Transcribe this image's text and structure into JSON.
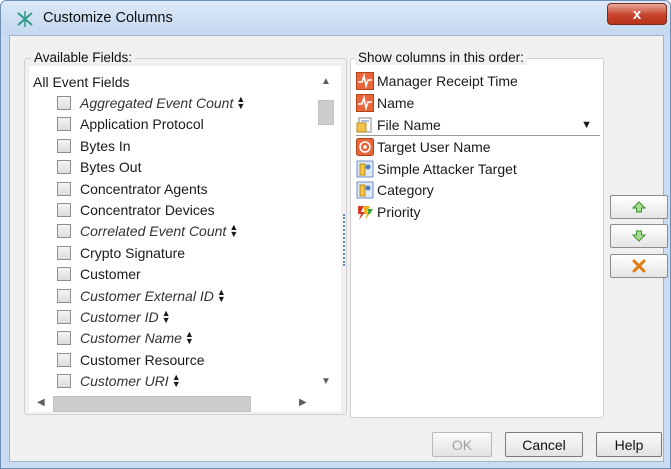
{
  "window": {
    "title": "Customize Columns",
    "close_label": "x"
  },
  "left_panel": {
    "group_label": "Available Fields:",
    "root_label": "All Event Fields",
    "fields": [
      {
        "label": "Aggregated Event Count",
        "italic": true,
        "sortable": true
      },
      {
        "label": "Application Protocol",
        "italic": false,
        "sortable": false
      },
      {
        "label": "Bytes In",
        "italic": false,
        "sortable": false
      },
      {
        "label": "Bytes Out",
        "italic": false,
        "sortable": false
      },
      {
        "label": "Concentrator Agents",
        "italic": false,
        "sortable": false
      },
      {
        "label": "Concentrator Devices",
        "italic": false,
        "sortable": false
      },
      {
        "label": "Correlated Event Count",
        "italic": true,
        "sortable": true
      },
      {
        "label": "Crypto Signature",
        "italic": false,
        "sortable": false
      },
      {
        "label": "Customer",
        "italic": false,
        "sortable": false
      },
      {
        "label": "Customer External ID",
        "italic": true,
        "sortable": true
      },
      {
        "label": "Customer ID",
        "italic": true,
        "sortable": true
      },
      {
        "label": "Customer Name",
        "italic": true,
        "sortable": true
      },
      {
        "label": "Customer Resource",
        "italic": false,
        "sortable": false
      },
      {
        "label": "Customer URI",
        "italic": true,
        "sortable": true
      }
    ]
  },
  "right_panel": {
    "group_label": "Show columns in this order:",
    "columns": [
      {
        "label": "Manager Receipt Time",
        "icon": "event-field-icon"
      },
      {
        "label": "Name",
        "icon": "event-field-icon"
      },
      {
        "label": "File Name",
        "icon": "file-icon"
      },
      {
        "label": "Target User Name",
        "icon": "target-icon"
      },
      {
        "label": "Simple Attacker Target",
        "icon": "resource-icon"
      },
      {
        "label": "Category",
        "icon": "resource-icon"
      },
      {
        "label": "Priority",
        "icon": "priority-icon"
      }
    ]
  },
  "side_buttons": {
    "up_icon": "arrow-up-icon",
    "down_icon": "arrow-down-icon",
    "remove_icon": "delete-x-icon"
  },
  "buttons": {
    "ok_label": "OK",
    "cancel_label": "Cancel",
    "help_label": "Help"
  },
  "colors": {
    "accent": "#5b8bc3",
    "close": "#c7432b",
    "up_arrow": "#4aa83a",
    "remove": "#e07a10"
  }
}
